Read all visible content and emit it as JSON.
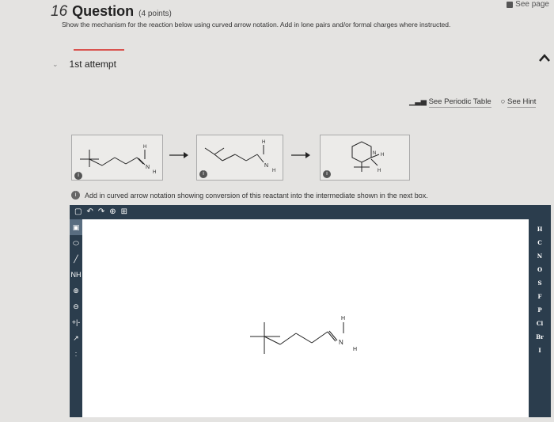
{
  "header": {
    "see_page": "See page",
    "question_number": "16",
    "question_word": "Question",
    "points": "(4 points)",
    "instructions": "Show the mechanism for the reaction below using curved arrow notation. Add in lone pairs and/or formal charges where instructed."
  },
  "attempt": {
    "label": "1st attempt"
  },
  "links": {
    "periodic_table": "See Periodic Table",
    "hint": "See Hint"
  },
  "mechanism": {
    "info_symbol": "i",
    "box1": {
      "atom_N": "N",
      "atom_H_top": "H",
      "atom_H": "H"
    },
    "box2": {
      "atom_N": "N",
      "atom_H_top": "H",
      "atom_H": "H"
    },
    "box3": {
      "atom_N": "N",
      "atom_H_top": "H",
      "atom_H": "H"
    }
  },
  "note": {
    "text": "Add in curved arrow notation showing conversion of this reactant into the intermediate shown in the next box."
  },
  "toolbar": {
    "items": [
      "▢",
      "↶",
      "↷",
      "⊕",
      "⊞"
    ]
  },
  "left_tools": {
    "items": [
      "▣",
      "⬭",
      "╱",
      "NH",
      "⊕",
      "⊖",
      "+|-",
      "↗",
      ":"
    ]
  },
  "elements": [
    "H",
    "C",
    "N",
    "O",
    "S",
    "F",
    "P",
    "Cl",
    "Br",
    "I"
  ],
  "canvas_molecule": {
    "atom_N": "N",
    "atom_H_top": "H",
    "atom_H": "H"
  }
}
